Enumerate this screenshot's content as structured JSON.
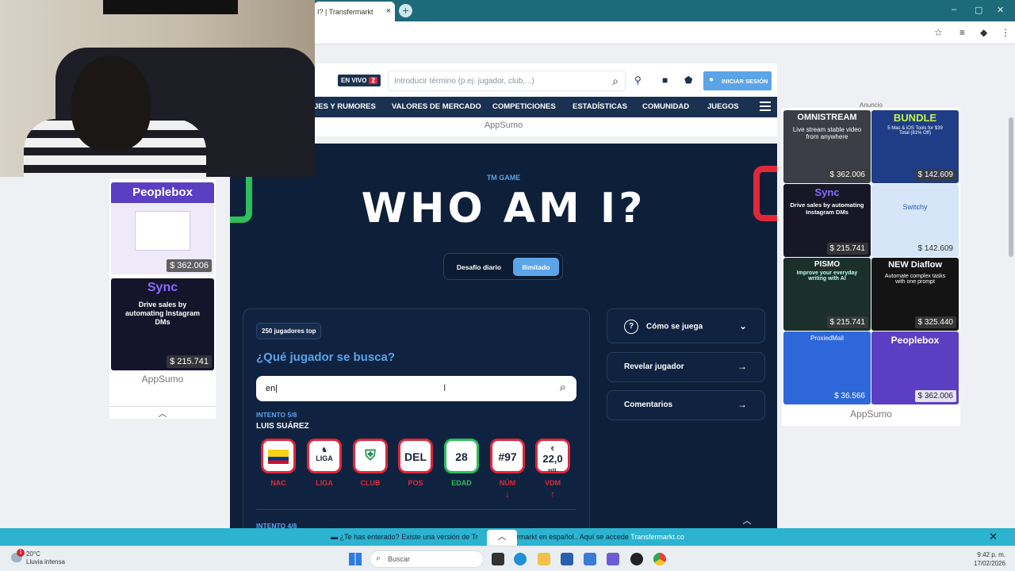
{
  "browser": {
    "tab_title": "I? | Transfermarkt",
    "tab_close": "×",
    "new_tab": "+",
    "controls": [
      "–",
      "▢",
      "✕"
    ]
  },
  "header": {
    "live_label": "EN VIVO",
    "live_count": "2",
    "search_placeholder": "Introducir término (p.ej. jugador, club,...)",
    "login_label": "INICIAR SESIÓN"
  },
  "nav": {
    "items": [
      "JES Y RUMORES",
      "VALORES DE MERCADO",
      "COMPETICIONES",
      "ESTADÍSTICAS",
      "COMUNIDAD",
      "JUEGOS"
    ]
  },
  "banner_label": "AppSumo",
  "game": {
    "eyebrow": "TM GAME",
    "title": "WHO AM I?",
    "modes": [
      "Desafío diario",
      "Ilimitado"
    ],
    "active_mode": "Ilimitado",
    "pool_label": "250 jugadores top",
    "question": "¿Qué jugador se busca?",
    "input_value": "en",
    "attempt_label": "INTENTO 5/8",
    "player_name": "LUIS SUÁREZ",
    "tiles": [
      {
        "value": "",
        "label": "NAC",
        "correct": false,
        "hint": ""
      },
      {
        "value": "",
        "label": "LIGA",
        "correct": false,
        "hint": ""
      },
      {
        "value": "",
        "label": "CLUB",
        "correct": false,
        "hint": ""
      },
      {
        "value": "DEL",
        "label": "POS",
        "correct": false,
        "hint": ""
      },
      {
        "value": "28",
        "label": "EDAD",
        "correct": true,
        "hint": ""
      },
      {
        "value": "#97",
        "label": "NÚM",
        "correct": false,
        "hint": "↓"
      },
      {
        "value": "22,0",
        "label": "VDM",
        "correct": false,
        "hint": "↑"
      }
    ],
    "vdm_prefix": "€",
    "vdm_suffix": "mill.",
    "prev_attempt_label": "INTENTO 4/8",
    "side_buttons": [
      "Cómo se juega",
      "Revelar jugador",
      "Comentarios"
    ]
  },
  "left_ads": [
    {
      "title": "Peoplebox",
      "price": "$ 362.006"
    },
    {
      "title": "Sync",
      "subtitle": "Drive sales by automating Instagram DMs",
      "price": "$ 215.741"
    }
  ],
  "left_ads_footer": "AppSumo",
  "right_ads_header": "Anuncio",
  "right_ads": [
    {
      "title": "OMNISTREAM",
      "subtitle": "Live stream stable video from anywhere",
      "price": "$ 362.006",
      "bg": "#3b3d47"
    },
    {
      "title": "BUNDLE",
      "subtitle": "5 Mac & iOS Tools for $39 Total (81% Off)",
      "price": "$ 142.609",
      "bg": "#1f3d86"
    },
    {
      "title": "Sync",
      "subtitle": "Drive sales by automating Instagram DMs",
      "price": "$ 215.741",
      "bg": "#171727"
    },
    {
      "title": "Switchy",
      "subtitle": "",
      "price": "$ 142.609",
      "bg": "#d6e6f8"
    },
    {
      "title": "PISMO",
      "subtitle": "Improve your everyday writing with AI",
      "price": "$ 215.741",
      "bg": "#1b2f2b"
    },
    {
      "title": "NEW Diaflow",
      "subtitle": "Automate complex tasks with one prompt",
      "price": "$ 325.440",
      "bg": "#141414"
    },
    {
      "title": "ProxiedMail",
      "subtitle": "",
      "price": "$ 36.566",
      "bg": "#2e67d9"
    },
    {
      "title": "Peoplebox",
      "subtitle": "",
      "price": "$ 362.006",
      "bg": "#5a3fc2"
    }
  ],
  "right_ads_footer": "AppSumo",
  "notification": {
    "text": "¿Te has enterado? Existe una versión de Tr",
    "text2": "ermarkt en español.. Aquí se accede",
    "link": "Transfermarkt.co",
    "close": "✕"
  },
  "taskbar": {
    "temperature": "20°C",
    "weather": "Lluvia intensa",
    "weather_badge": "1",
    "search_label": "Buscar",
    "time": "9:42 p. m.",
    "date": "17/02/2026"
  }
}
